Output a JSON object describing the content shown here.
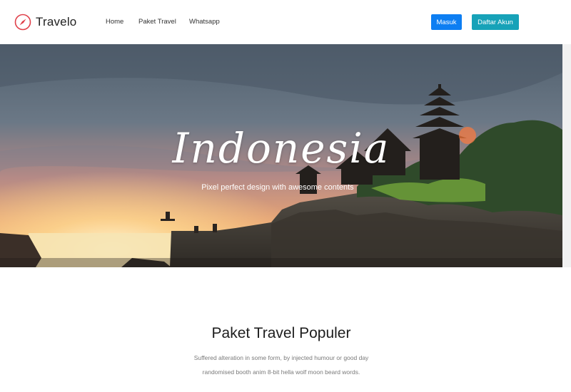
{
  "brand": {
    "name": "Travelo",
    "icon": "compass-icon",
    "color": "#e0404a"
  },
  "nav": {
    "links": [
      "Home",
      "Paket Travel",
      "Whatsapp"
    ],
    "login_label": "Masuk",
    "register_label": "Daftar Akun"
  },
  "hero": {
    "title": "Indonesia",
    "subtitle": "Pixel perfect design with awesome contents"
  },
  "section": {
    "title": "Paket Travel Populer",
    "description_line1": "Suffered alteration in some form, by injected humour or good day",
    "description_line2": "randomised booth anim 8-bit hella wolf moon beard words."
  },
  "colors": {
    "primary": "#0d7ef2",
    "info": "#17a2b8"
  }
}
